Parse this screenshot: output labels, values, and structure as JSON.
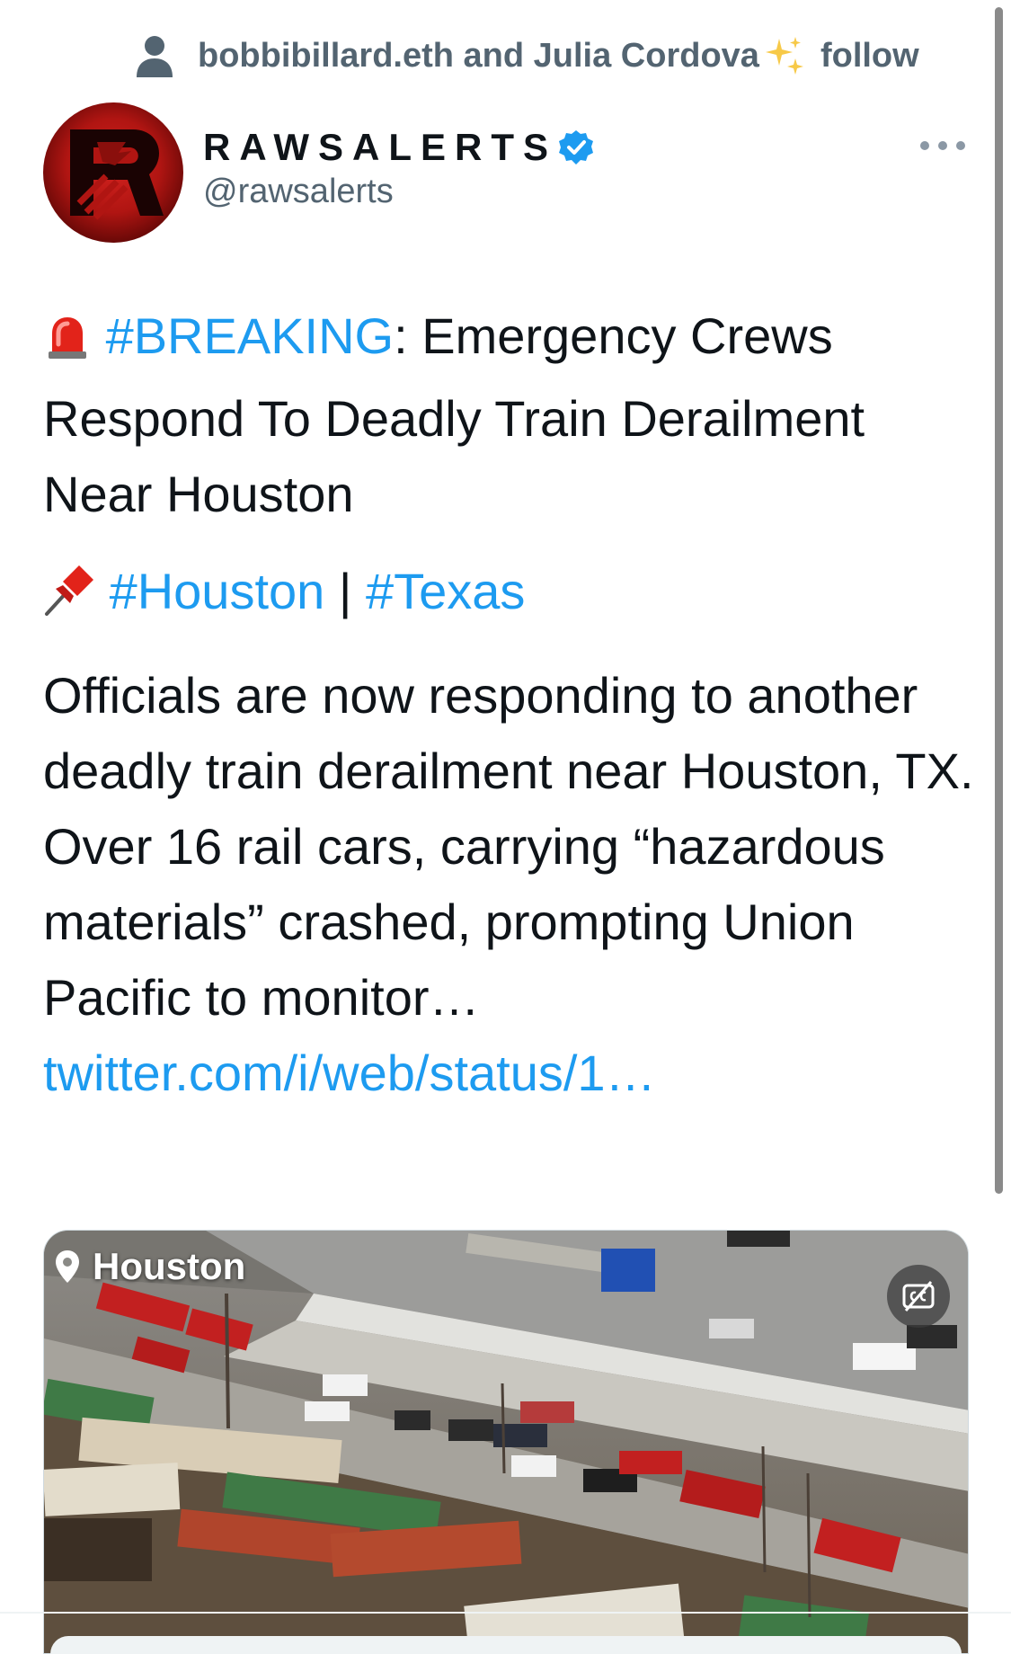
{
  "social_context": {
    "icon": "person-icon",
    "text": "bobbibillard.eth and Julia Cordova",
    "sparkle": "✨",
    "action": "follow"
  },
  "author": {
    "display_name": "RAWSALERTS",
    "handle": "@rawsalerts",
    "verified": true,
    "avatar_letter": "R"
  },
  "tweet": {
    "line1_emoji": "🚨",
    "line1_hashtag": "#BREAKING",
    "line1_text": ": Emergency Crews Respond To Deadly Train Derailment Near Houston",
    "line2_emoji": "📌",
    "line2_hashtag1": "#Houston",
    "line2_separator": " | ",
    "line2_hashtag2": "#Texas",
    "body_text": "Officials are now responding to another deadly train derailment near Houston, TX. Over 16 rail cars, carrying “hazardous materials” crashed, prompting Union Pacific to monitor… ",
    "link_text": "twitter.com/i/web/status/1…"
  },
  "media": {
    "location_label": "Houston"
  },
  "colors": {
    "link": "#1d9bf0",
    "secondary_text": "#536471",
    "verified": "#1d9bf0",
    "avatar_red": "#c01a16"
  }
}
